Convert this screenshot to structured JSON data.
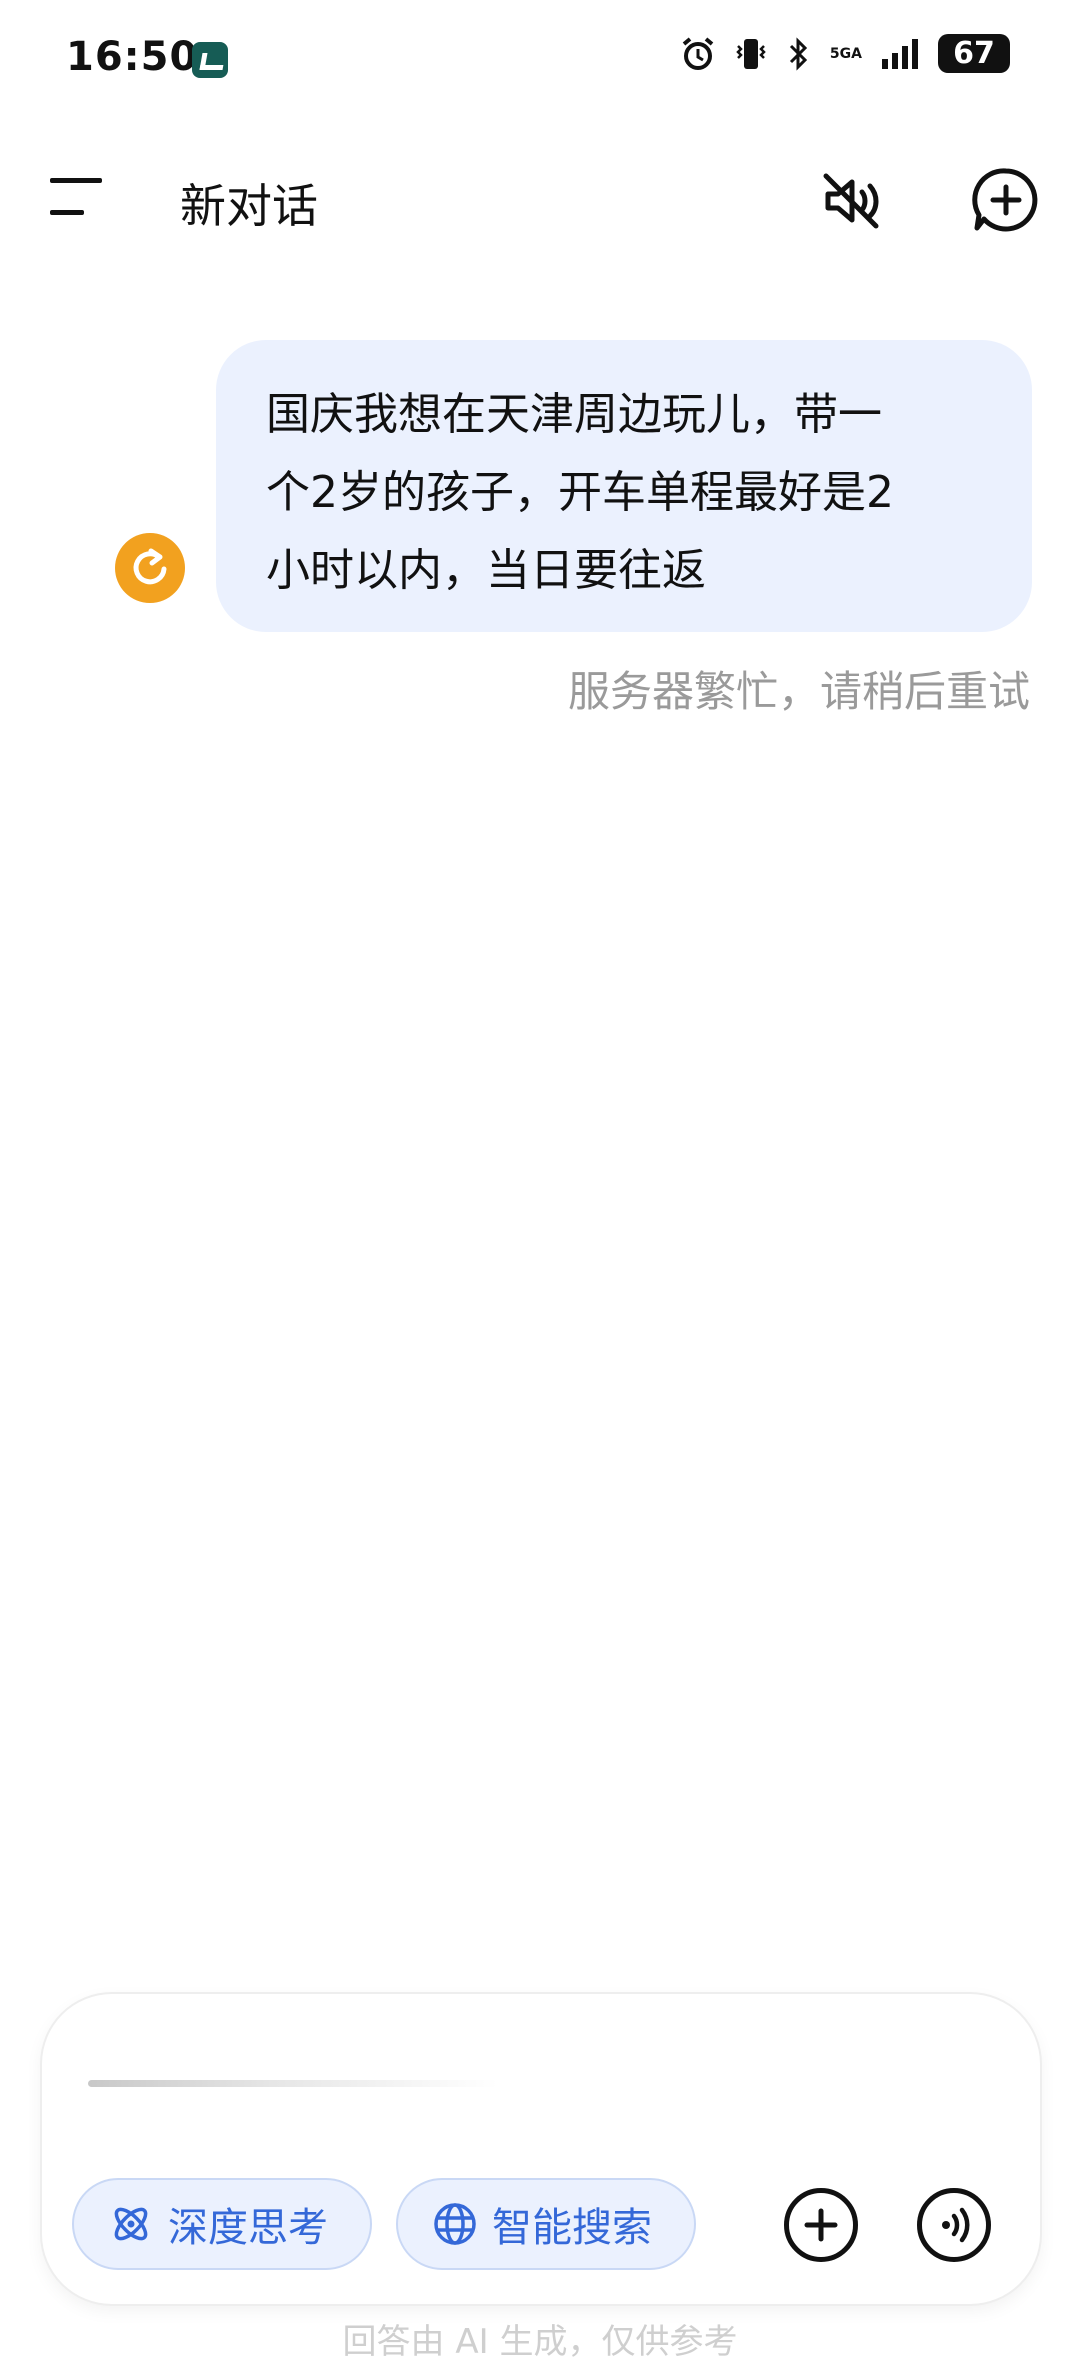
{
  "status_bar": {
    "time": "16:50",
    "network": "5GA",
    "battery": "67",
    "icons": [
      "alarm-icon",
      "vibrate-icon",
      "bluetooth-icon",
      "signal-icon",
      "battery-icon"
    ]
  },
  "header": {
    "title": "新对话",
    "icons": [
      "menu-icon",
      "mute-icon",
      "new-chat-icon"
    ]
  },
  "chat": {
    "user_message_lines": [
      "国庆我想在天津周边玩儿，带一",
      "个2岁的孩子，开车单程最好是2",
      "小时以内，当日要往返"
    ],
    "error_text": "服务器繁忙，请稍后重试",
    "retry_icon": "retry-icon"
  },
  "composer": {
    "deep_think_label": "深度思考",
    "smart_search_label": "智能搜索",
    "icons": [
      "atom-icon",
      "globe-icon",
      "plus-icon",
      "voice-icon"
    ]
  },
  "footer_note": "回答由 AI 生成，仅供参考",
  "colors": {
    "bubble": "#ebf1fe",
    "accent_blue": "#3468d8",
    "retry_orange": "#f2a11f",
    "error_gray": "#9a9a9a"
  }
}
